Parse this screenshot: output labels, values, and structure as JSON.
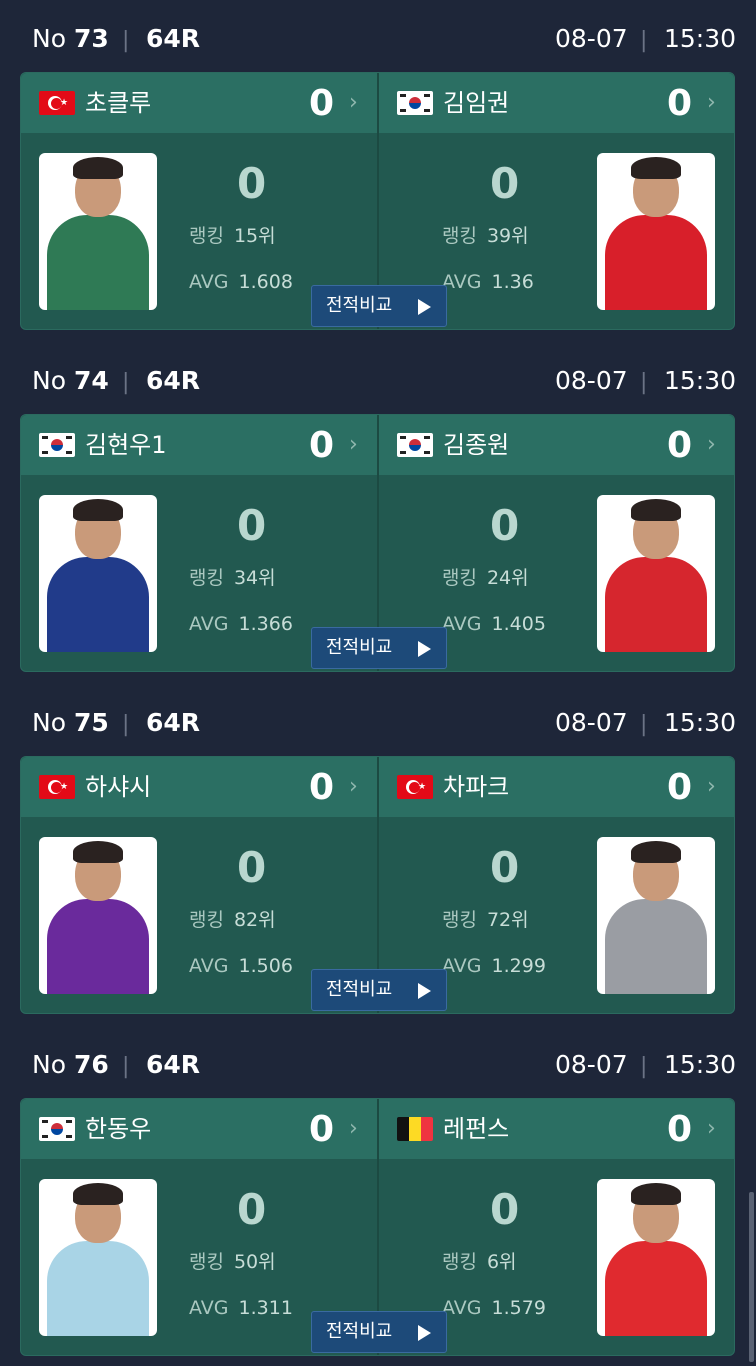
{
  "matches": [
    {
      "no_label": "No",
      "no": "73",
      "round": "64R",
      "date": "08-07",
      "time": "15:30",
      "left": {
        "country": "turkey",
        "name": "초클루",
        "score": "0",
        "frames": "0",
        "rank": "15위",
        "avg": "1.608",
        "shirt": "#2f7a55"
      },
      "right": {
        "country": "korea",
        "name": "김임권",
        "score": "0",
        "frames": "0",
        "rank": "39위",
        "avg": "1.36",
        "shirt": "#d81f2a"
      }
    },
    {
      "no_label": "No",
      "no": "74",
      "round": "64R",
      "date": "08-07",
      "time": "15:30",
      "left": {
        "country": "korea",
        "name": "김현우1",
        "score": "0",
        "frames": "0",
        "rank": "34위",
        "avg": "1.366",
        "shirt": "#213b8a"
      },
      "right": {
        "country": "korea",
        "name": "김종원",
        "score": "0",
        "frames": "0",
        "rank": "24위",
        "avg": "1.405",
        "shirt": "#d6262e"
      }
    },
    {
      "no_label": "No",
      "no": "75",
      "round": "64R",
      "date": "08-07",
      "time": "15:30",
      "left": {
        "country": "turkey",
        "name": "하샤시",
        "score": "0",
        "frames": "0",
        "rank": "82위",
        "avg": "1.506",
        "shirt": "#6a2a9c"
      },
      "right": {
        "country": "turkey",
        "name": "차파크",
        "score": "0",
        "frames": "0",
        "rank": "72위",
        "avg": "1.299",
        "shirt": "#9a9da3"
      }
    },
    {
      "no_label": "No",
      "no": "76",
      "round": "64R",
      "date": "08-07",
      "time": "15:30",
      "left": {
        "country": "korea",
        "name": "한동우",
        "score": "0",
        "frames": "0",
        "rank": "50위",
        "avg": "1.311",
        "shirt": "#a9d4e6"
      },
      "right": {
        "country": "belgium",
        "name": "레펀스",
        "score": "0",
        "frames": "0",
        "rank": "6위",
        "avg": "1.579",
        "shirt": "#e02a2f"
      }
    }
  ],
  "labels": {
    "rank": "랭킹",
    "avg": "AVG",
    "compare": "전적비교",
    "chevron": "›",
    "separator": "|"
  },
  "colors": {
    "background": "#1e2639",
    "card": "#225950",
    "card_header": "#2b6f63",
    "compare_button": "#1d4a79"
  }
}
